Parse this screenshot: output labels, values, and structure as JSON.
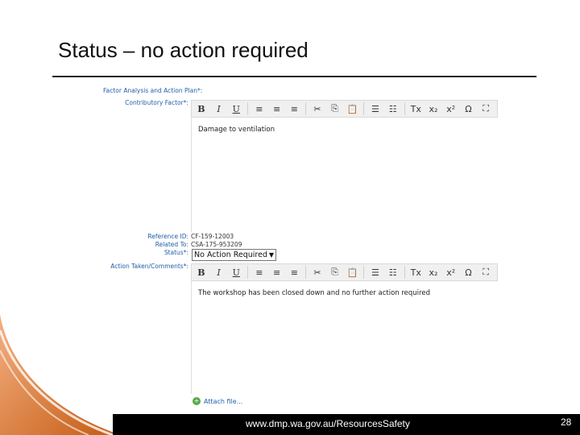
{
  "slide": {
    "title": "Status – no action required",
    "footer_url": "www.dmp.wa.gov.au/ResourcesSafety",
    "page_number": "28"
  },
  "form": {
    "section_label": "Factor Analysis and Action Plan*:",
    "contributory_label": "Contributory Factor*:",
    "contributory_text": "Damage to ventilation",
    "reference_label": "Reference ID:",
    "reference_value": "CF-159-12003",
    "related_label": "Related To:",
    "related_value": "CSA-175-953209",
    "status_label": "Status*:",
    "status_value": "No Action Required",
    "action_label": "Action Taken/Comments*:",
    "action_text": "The workshop has been closed down and no further action required",
    "attach_label": "Attach file..."
  },
  "toolbar_buttons": [
    "B",
    "I",
    "U",
    "≡",
    "≡",
    "≡",
    "✂",
    "⎘",
    "📋",
    "☰",
    "☷",
    "Tx",
    "x₂",
    "x²",
    "Ω",
    "⛶"
  ],
  "colors": {
    "label_blue": "#1f5fa8",
    "accent_orange": "#d9621f",
    "footer_black": "#000000"
  }
}
